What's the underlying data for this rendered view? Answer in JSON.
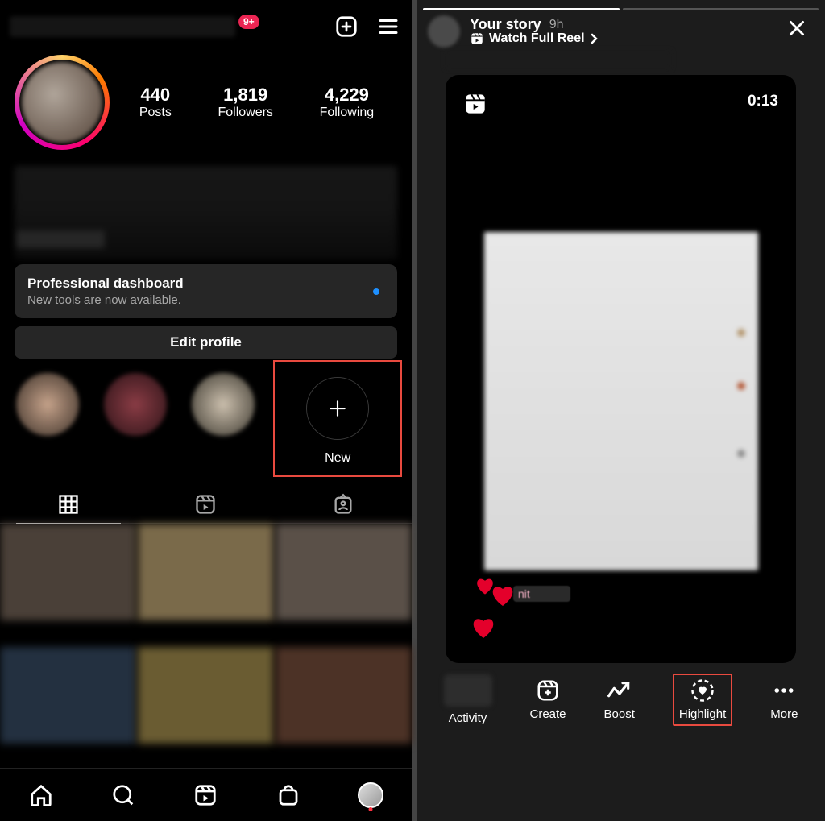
{
  "left": {
    "notif_badge": "9+",
    "stats": {
      "posts_n": "440",
      "posts_l": "Posts",
      "followers_n": "1,819",
      "followers_l": "Followers",
      "following_n": "4,229",
      "following_l": "Following"
    },
    "pro_title": "Professional dashboard",
    "pro_sub": "New tools are now available.",
    "edit_label": "Edit profile",
    "hl_new_label": "New"
  },
  "right": {
    "story_title": "Your story",
    "story_time": "9h",
    "watch_label": "Watch Full Reel",
    "reel_time": "0:13",
    "viewer_prefix": "nit",
    "tools": {
      "activity": "Activity",
      "create": "Create",
      "boost": "Boost",
      "highlight": "Highlight",
      "more": "More"
    }
  }
}
